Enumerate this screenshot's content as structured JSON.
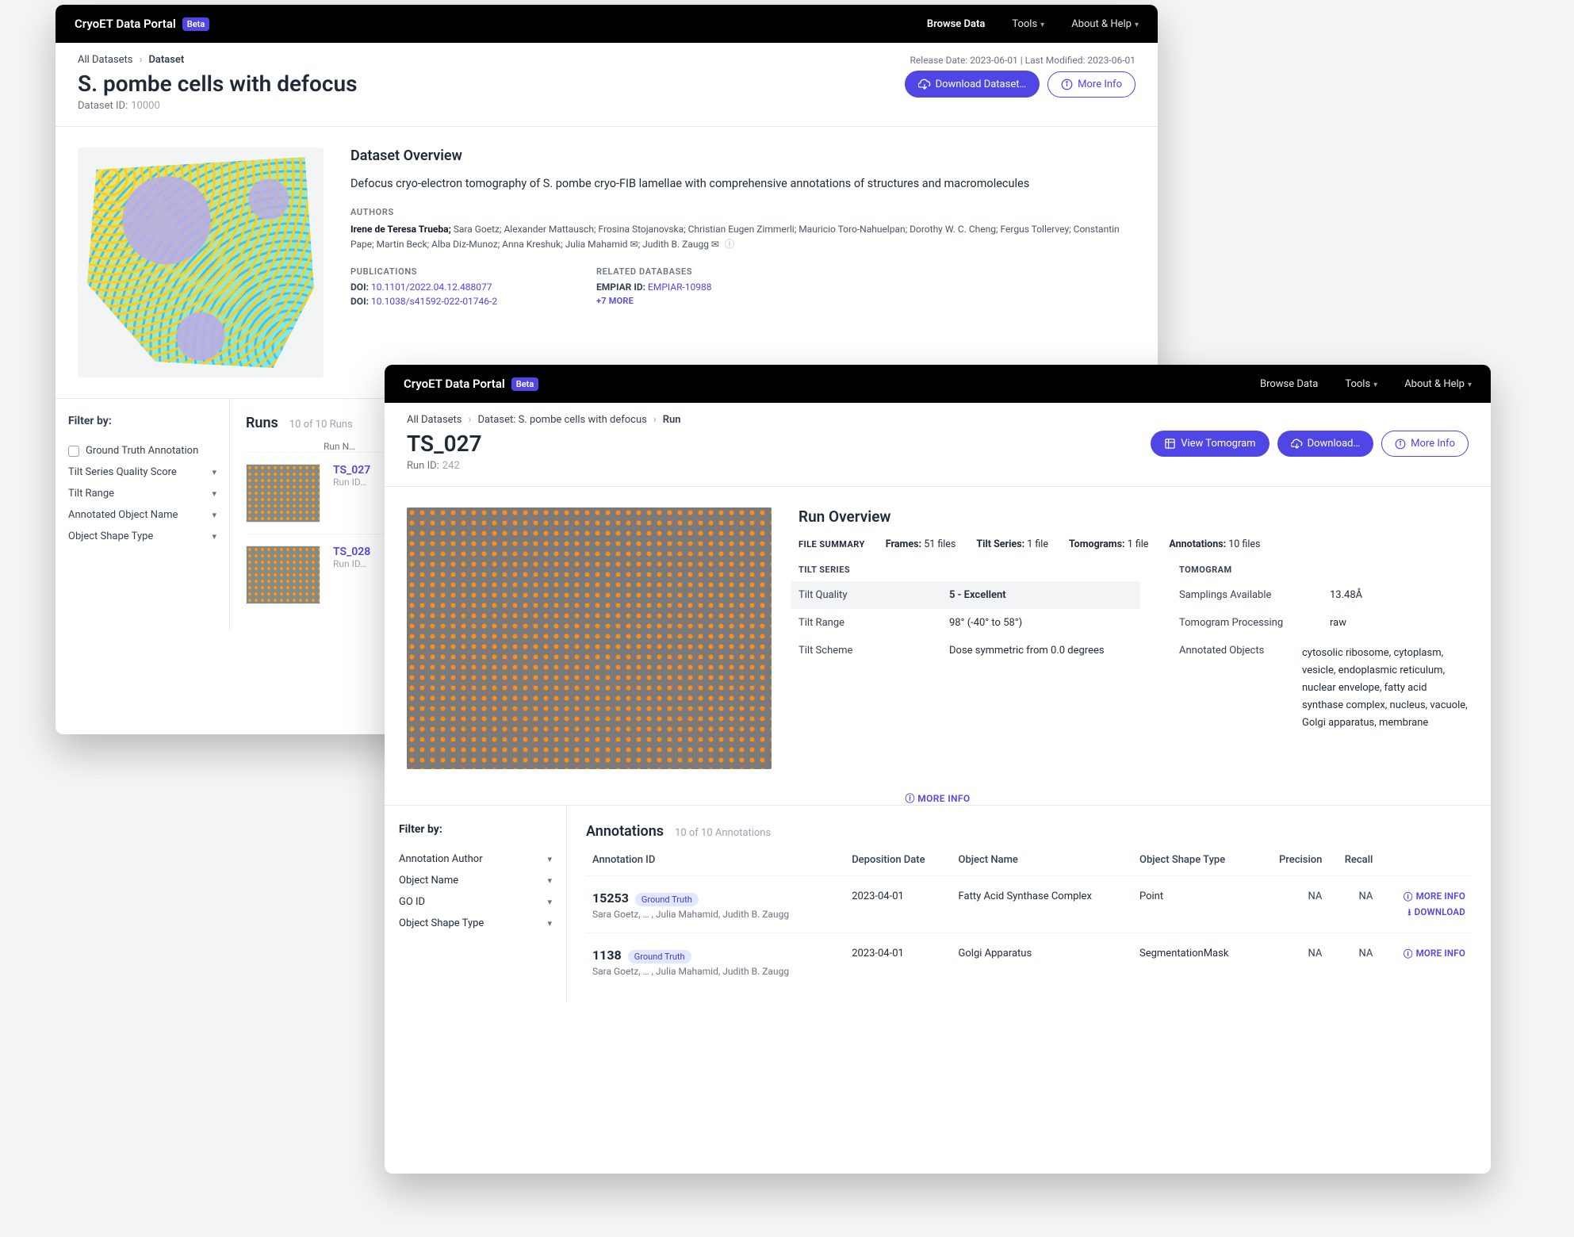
{
  "brand": "CryoET Data Portal",
  "beta": "Beta",
  "topnav": {
    "browse": "Browse Data",
    "tools": "Tools",
    "about": "About & Help"
  },
  "w1": {
    "crumbs": {
      "root": "All Datasets",
      "current": "Dataset"
    },
    "dates": "Release Date: 2023-06-01 | Last Modified: 2023-06-01",
    "title": "S. pombe cells with defocus",
    "id_label": "Dataset ID:",
    "id_value": "10000",
    "download_btn": "Download Dataset…",
    "moreinfo_btn": "More Info",
    "ov_heading": "Dataset Overview",
    "ov_desc": "Defocus cryo-electron tomography of S. pombe cryo-FIB lamellae with comprehensive annotations of structures and macromolecules",
    "authors_label": "AUTHORS",
    "authors_lead": "Irene de Teresa Trueba;",
    "authors_rest": " Sara Goetz; Alexander Mattausch; Frosina Stojanovska; Christian Eugen Zimmerli; Mauricio Toro-Nahuelpan; Dorothy W. C. Cheng; Fergus Tollervey; Constantin Pape; Martin Beck; Alba Diz-Munoz; Anna Kreshuk; Julia Mahamid ✉; Judith B. Zaugg ✉",
    "publications_label": "PUBLICATIONS",
    "doi_label": "DOI:",
    "doi1": "10.1101/2022.04.12.488077",
    "doi2": "10.1038/s41592-022-01746-2",
    "related_db_label": "RELATED DATABASES",
    "empiar_label": "EMPIAR ID:",
    "empiar": "EMPIAR-10988",
    "seven_more": "+7 MORE",
    "filters": {
      "heading": "Filter by:",
      "ground_truth": "Ground Truth Annotation",
      "items": [
        "Tilt Series Quality Score",
        "Tilt Range",
        "Annotated Object Name",
        "Object Shape Type"
      ]
    },
    "runs": {
      "title": "Runs",
      "count": "10 of 10 Runs",
      "colhdr": "Run N…",
      "items": [
        {
          "name": "TS_027",
          "sub": "Run ID…"
        },
        {
          "name": "TS_028",
          "sub": "Run ID…"
        }
      ]
    }
  },
  "w2": {
    "crumbs": {
      "root": "All Datasets",
      "mid": "Dataset: S. pombe cells with defocus",
      "current": "Run"
    },
    "title": "TS_027",
    "id_label": "Run ID:",
    "id_value": "242",
    "view_btn": "View Tomogram",
    "download_btn": "Download…",
    "moreinfo_btn": "More Info",
    "ro_heading": "Run Overview",
    "file_summary_label": "FILE SUMMARY",
    "file_summary": {
      "frames_l": "Frames:",
      "frames_v": "51 files",
      "tilt_l": "Tilt Series:",
      "tilt_v": "1 file",
      "tomo_l": "Tomograms:",
      "tomo_v": "1 file",
      "ann_l": "Annotations:",
      "ann_v": "10 files"
    },
    "tilt_series_label": "TILT SERIES",
    "tilt": {
      "quality_l": "Tilt Quality",
      "quality_v": "5 - Excellent",
      "range_l": "Tilt Range",
      "range_v": "98° (-40° to 58°)",
      "scheme_l": "Tilt Scheme",
      "scheme_v": "Dose symmetric from 0.0 degrees"
    },
    "tomogram_label": "TOMOGRAM",
    "tomo": {
      "samplings_l": "Samplings Available",
      "samplings_v": "13.48Å",
      "processing_l": "Tomogram Processing",
      "processing_v": "raw",
      "objects_l": "Annotated Objects",
      "objects_v": "cytosolic ribosome, cytoplasm, vesicle, endoplasmic reticulum, nuclear envelope, fatty acid synthase complex, nucleus, vacuole, Golgi apparatus, membrane"
    },
    "more_info_link": "MORE INFO",
    "filters": {
      "heading": "Filter by:",
      "items": [
        "Annotation Author",
        "Object Name",
        "GO ID",
        "Object Shape Type"
      ]
    },
    "ann": {
      "title": "Annotations",
      "count": "10 of 10 Annotations",
      "cols": [
        "Annotation ID",
        "Deposition Date",
        "Object Name",
        "Object Shape Type",
        "Precision",
        "Recall",
        ""
      ],
      "row_more": "MORE INFO",
      "row_download": "DOWNLOAD",
      "rows": [
        {
          "id": "15253",
          "gt": "Ground Truth",
          "authors": "Sara Goetz, … , Julia Mahamid, Judith B. Zaugg",
          "date": "2023-04-01",
          "object": "Fatty Acid Synthase Complex",
          "shape": "Point",
          "precision": "NA",
          "recall": "NA",
          "dl": true
        },
        {
          "id": "1138",
          "gt": "Ground Truth",
          "authors": "Sara Goetz, … , Julia Mahamid, Judith B. Zaugg",
          "date": "2023-04-01",
          "object": "Golgi Apparatus",
          "shape": "SegmentationMask",
          "precision": "NA",
          "recall": "NA",
          "dl": false
        }
      ]
    }
  }
}
